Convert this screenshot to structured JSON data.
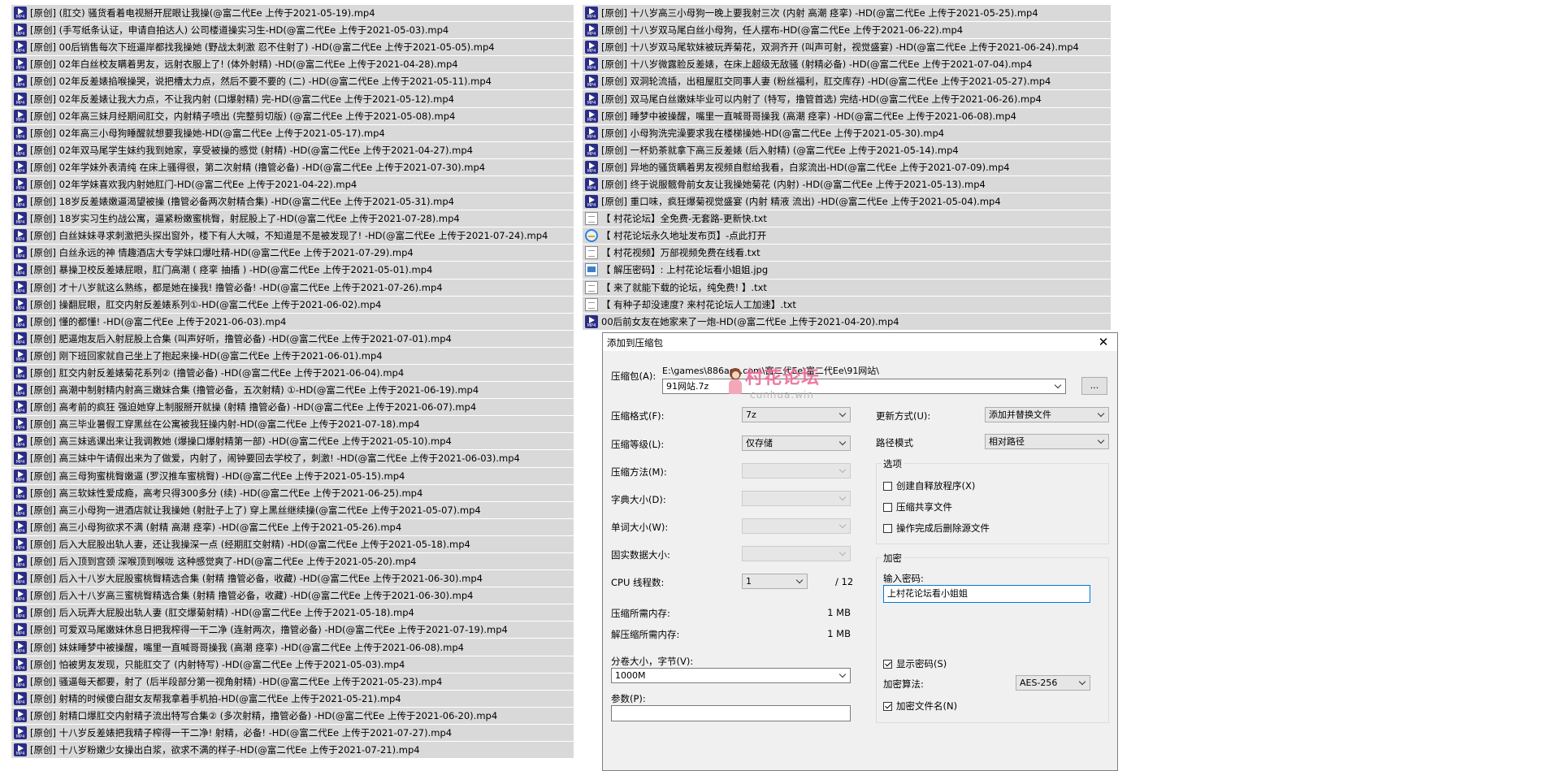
{
  "file_list": {
    "left": [
      {
        "name": "[原创]  (肛交) 骚货看着电视掰开屁眼让我操(@富二代Ee 上传于2021-05-19).mp4",
        "icon": "mp4-file-icon"
      },
      {
        "name": "[原创]  (手写纸条认证，申请自拍达人) 公司楼道操实习生-HD(@富二代Ee 上传于2021-05-03).mp4",
        "icon": "mp4-file-icon"
      },
      {
        "name": "[原创] 00后销售每次下班逼岸都找我操她 (野战太刺激 忍不住射了) -HD(@富二代Ee 上传于2021-05-05).mp4",
        "icon": "mp4-file-icon"
      },
      {
        "name": "[原创] 02年白丝校友瞒着男友，远射衣服上了! (体外射精) -HD(@富二代Ee 上传于2021-04-28).mp4",
        "icon": "mp4-file-icon"
      },
      {
        "name": "[原创] 02年反差婊掐喉操哭，说把槽太力点，然后不要不要的 (二) -HD(@富二代Ee 上传于2021-05-11).mp4",
        "icon": "mp4-file-icon"
      },
      {
        "name": "[原创] 02年反差婊让我大力点，不让我内射 (口爆射精) 完-HD(@富二代Ee 上传于2021-05-12).mp4",
        "icon": "mp4-file-icon"
      },
      {
        "name": "[原创] 02年高三妹月经期间肛交，内射精子喷出 (完整剪切版) (@富二代Ee 上传于2021-05-08).mp4",
        "icon": "mp4-file-icon"
      },
      {
        "name": "[原创] 02年高三小母狗睡醒就想要我操她-HD(@富二代Ee 上传于2021-05-17).mp4",
        "icon": "mp4-file-icon"
      },
      {
        "name": "[原创] 02年双马尾学生妹约我到她家，享受被操的感觉 (射精) -HD(@富二代Ee 上传于2021-04-27).mp4",
        "icon": "mp4-file-icon"
      },
      {
        "name": "[原创] 02年学妹外表清纯 在床上骚得很，第二次射精 (撸管必备) -HD(@富二代Ee 上传于2021-07-30).mp4",
        "icon": "mp4-file-icon"
      },
      {
        "name": "[原创] 02年学妹喜欢我内射她肛门-HD(@富二代Ee 上传于2021-04-22).mp4",
        "icon": "mp4-file-icon"
      },
      {
        "name": "[原创] 18岁反差婊嫩逼渴望被操 (撸管必备两次射精合集) -HD(@富二代Ee 上传于2021-05-31).mp4",
        "icon": "mp4-file-icon"
      },
      {
        "name": "[原创] 18岁实习生约战公寓，逼紧粉嫩蜜桃臀，射屁股上了-HD(@富二代Ee 上传于2021-07-28).mp4",
        "icon": "mp4-file-icon"
      },
      {
        "name": "[原创] 白丝妹妹寻求刺激把头探出窗外，楼下有人大喊，不知道是不是被发现了! -HD(@富二代Ee 上传于2021-07-24).mp4",
        "icon": "mp4-file-icon"
      },
      {
        "name": "[原创] 白丝永远的神 情趣酒店大专学妹口爆吐精-HD(@富二代Ee 上传于2021-07-29).mp4",
        "icon": "mp4-file-icon"
      },
      {
        "name": "[原创] 暴操卫校反差婊屁眼，肛门高潮 ( 痉挛 抽搐 ) -HD(@富二代Ee 上传于2021-05-01).mp4",
        "icon": "mp4-file-icon"
      },
      {
        "name": "[原创] 才十八岁就这么熟练，都是她在操我! 撸管必备! -HD(@富二代Ee 上传于2021-07-26).mp4",
        "icon": "mp4-file-icon"
      },
      {
        "name": "[原创] 操翻屁眼，肛交内射反差婊系列①-HD(@富二代Ee 上传于2021-06-02).mp4",
        "icon": "mp4-file-icon"
      },
      {
        "name": "[原创] 懂的都懂! -HD(@富二代Ee 上传于2021-06-03).mp4",
        "icon": "mp4-file-icon"
      },
      {
        "name": "[原创] 肥逼炮友后入射屁股上合集 (叫声好听，撸管必备) -HD(@富二代Ee 上传于2021-07-01).mp4",
        "icon": "mp4-file-icon"
      },
      {
        "name": "[原创] 刚下班回家就自己坐上了抱起来操-HD(@富二代Ee 上传于2021-06-01).mp4",
        "icon": "mp4-file-icon"
      },
      {
        "name": "[原创] 肛交内射反差婊菊花系列② (撸管必备) -HD(@富二代Ee 上传于2021-06-04).mp4",
        "icon": "mp4-file-icon"
      },
      {
        "name": "[原创] 高潮中制射精内射高三嫩妹合集 (撸管必备，五次射精) ①-HD(@富二代Ee 上传于2021-06-19).mp4",
        "icon": "mp4-file-icon"
      },
      {
        "name": "[原创] 高考前的疯狂 强迫她穿上制服掰开就操 (射精 撸管必备) -HD(@富二代Ee 上传于2021-06-07).mp4",
        "icon": "mp4-file-icon"
      },
      {
        "name": "[原创] 高三毕业暑假工穿黑丝在公寓被我狂操内射-HD(@富二代Ee 上传于2021-07-18).mp4",
        "icon": "mp4-file-icon"
      },
      {
        "name": "[原创] 高三妹逃课出来让我调教她 (爆操口爆射精第一部) -HD(@富二代Ee 上传于2021-05-10).mp4",
        "icon": "mp4-file-icon"
      },
      {
        "name": "[原创] 高三妹中午请假出来为了做爱，内射了，闹钟要回去学校了，刺激! -HD(@富二代Ee 上传于2021-06-03).mp4",
        "icon": "mp4-file-icon"
      },
      {
        "name": "[原创] 高三母狗蜜桃臀嫩逼 (罗汉推车蜜桃臀) -HD(@富二代Ee 上传于2021-05-15).mp4",
        "icon": "mp4-file-icon"
      },
      {
        "name": "[原创] 高三软妹性爱成瘾，高考只得300多分 (续) -HD(@富二代Ee 上传于2021-06-25).mp4",
        "icon": "mp4-file-icon"
      },
      {
        "name": "[原创] 高三小母狗一进酒店就让我操她 (射肚子上了) 穿上黑丝继续操(@富二代Ee 上传于2021-05-07).mp4",
        "icon": "mp4-file-icon"
      },
      {
        "name": "[原创] 高三小母狗欲求不满 (射精 高潮 痉挛) -HD(@富二代Ee 上传于2021-05-26).mp4",
        "icon": "mp4-file-icon"
      },
      {
        "name": "[原创] 后入大屁股出轨人妻，还让我操深一点 (经期肛交射精) -HD(@富二代Ee 上传于2021-05-18).mp4",
        "icon": "mp4-file-icon"
      },
      {
        "name": "[原创] 后入顶到宫颈 深喉顶到喉咙 这种感觉爽了-HD(@富二代Ee 上传于2021-05-20).mp4",
        "icon": "mp4-file-icon"
      },
      {
        "name": "[原创] 后入十八岁大屁股蜜桃臀精选合集 (射精 撸管必备，收藏) -HD(@富二代Ee 上传于2021-06-30).mp4",
        "icon": "mp4-file-icon"
      },
      {
        "name": "[原创] 后入十八岁高三蜜桃臀精选合集 (射精 撸管必备，收藏) -HD(@富二代Ee 上传于2021-06-30).mp4",
        "icon": "mp4-file-icon"
      },
      {
        "name": "[原创] 后入玩弄大屁股出轨人妻 (肛交爆菊射精) -HD(@富二代Ee 上传于2021-05-18).mp4",
        "icon": "mp4-file-icon"
      },
      {
        "name": "[原创] 可爱双马尾嫩妹休息日把我榨得一干二净 (连射两次，撸管必备) -HD(@富二代Ee 上传于2021-07-19).mp4",
        "icon": "mp4-file-icon"
      },
      {
        "name": "[原创] 妹妹睡梦中被操醒，嘴里一直喊哥哥操我 (高潮 痉挛) -HD(@富二代Ee 上传于2021-06-08).mp4",
        "icon": "mp4-file-icon"
      },
      {
        "name": "[原创] 怕被男友发现，只能肛交了 (内射特写) -HD(@富二代Ee 上传于2021-05-03).mp4",
        "icon": "mp4-file-icon"
      },
      {
        "name": "[原创] 骚逼每天都要，射了 (后半段部分第一视角射精) -HD(@富二代Ee 上传于2021-05-23).mp4",
        "icon": "mp4-file-icon"
      },
      {
        "name": "[原创] 射精的时候傻白甜女友帮我拿着手机拍-HD(@富二代Ee 上传于2021-05-21).mp4",
        "icon": "mp4-file-icon"
      },
      {
        "name": "[原创] 射精口爆肛交内射精子流出特写合集② (多次射精，撸管必备) -HD(@富二代Ee 上传于2021-06-20).mp4",
        "icon": "mp4-file-icon"
      },
      {
        "name": "[原创] 十八岁反差婊把我精子榨得一干二净! 射精，必备! -HD(@富二代Ee 上传于2021-07-27).mp4",
        "icon": "mp4-file-icon"
      },
      {
        "name": "[原创] 十八岁粉嫩少女操出白浆，欲求不满的样子-HD(@富二代Ee 上传于2021-07-21).mp4",
        "icon": "mp4-file-icon"
      }
    ],
    "right": [
      {
        "name": "[原创] 十八岁高三小母狗一晚上要我射三次 (内射 高潮 痉挛) -HD(@富二代Ee 上传于2021-05-25).mp4",
        "icon": "mp4-file-icon"
      },
      {
        "name": "[原创] 十八岁双马尾白丝小母狗，任人摆布-HD(@富二代Ee 上传于2021-06-22).mp4",
        "icon": "mp4-file-icon"
      },
      {
        "name": "[原创] 十八岁双马尾软妹被玩弄菊花，双洞齐开 (叫声可射，视觉盛宴) -HD(@富二代Ee 上传于2021-06-24).mp4",
        "icon": "mp4-file-icon"
      },
      {
        "name": "[原创] 十八岁微露脸反差婊，在床上超级无敌骚 (射精必备) -HD(@富二代Ee 上传于2021-07-04).mp4",
        "icon": "mp4-file-icon"
      },
      {
        "name": "[原创] 双洞轮流插，出租屋肛交同事人妻 (粉丝福利，肛交库存) -HD(@富二代Ee 上传于2021-05-27).mp4",
        "icon": "mp4-file-icon"
      },
      {
        "name": "[原创] 双马尾白丝嫩妹毕业可以内射了 (特写，撸管首选) 完结-HD(@富二代Ee 上传于2021-06-26).mp4",
        "icon": "mp4-file-icon"
      },
      {
        "name": "[原创] 睡梦中被操醒，嘴里一直喊哥哥操我 (高潮 痉挛) -HD(@富二代Ee 上传于2021-06-08).mp4",
        "icon": "mp4-file-icon"
      },
      {
        "name": "[原创] 小母狗洗完澡要求我在楼梯操她-HD(@富二代Ee 上传于2021-05-30).mp4",
        "icon": "mp4-file-icon"
      },
      {
        "name": "[原创] 一杯奶茶就拿下高三反差婊 (后入射精) (@富二代Ee 上传于2021-05-14).mp4",
        "icon": "mp4-file-icon"
      },
      {
        "name": "[原创] 异地的骚货瞒着男友视频自慰给我看，白浆流出-HD(@富二代Ee 上传于2021-07-09).mp4",
        "icon": "mp4-file-icon"
      },
      {
        "name": "[原创] 终于说服髋骨前女友让我操她菊花 (内射) -HD(@富二代Ee 上传于2021-05-13).mp4",
        "icon": "mp4-file-icon"
      },
      {
        "name": "[原创] 重口味，疯狂爆菊视觉盛宴 (内射 精液 流出) -HD(@富二代Ee 上传于2021-05-04).mp4",
        "icon": "mp4-file-icon"
      },
      {
        "name": "【 村花论坛】全免费-无套路-更新快.txt",
        "icon": "text-file-icon"
      },
      {
        "name": "【 村花论坛永久地址发布页】-点此打开",
        "icon": "internet-shortcut-icon"
      },
      {
        "name": "【 村花视频】万部视频免费在线看.txt",
        "icon": "text-file-icon"
      },
      {
        "name": "【 解压密码】: 上村花论坛看小姐姐.jpg",
        "icon": "image-file-icon"
      },
      {
        "name": "【 来了就能下载的论坛，纯免费! 】.txt",
        "icon": "text-file-icon"
      },
      {
        "name": "【 有种子却没速度? 来村花论坛人工加速】.txt",
        "icon": "text-file-icon"
      },
      {
        "name": "00后前女友在她家来了一炮-HD(@富二代Ee 上传于2021-04-20).mp4",
        "icon": "mp4-file-icon"
      }
    ]
  },
  "dialog": {
    "title": "添加到压缩包",
    "close_glyph": "✕",
    "archive_label": "压缩包(A):",
    "archive_path": "E:\\games\\886acg.com\\富二代Ee\\富二代Ee\\91网站\\",
    "archive_name": "91网站.7z",
    "browse_label": "...",
    "format_label": "压缩格式(F):",
    "format_value": "7z",
    "level_label": "压缩等级(L):",
    "level_value": "仅存储",
    "method_label": "压缩方法(M):",
    "method_value": "",
    "dict_label": "字典大小(D):",
    "dict_value": "",
    "word_label": "单词大小(W):",
    "word_value": "",
    "solid_label": "固实数据大小:",
    "solid_value": "",
    "cpu_label": "CPU 线程数:",
    "cpu_value": "1",
    "cpu_max": "/ 12",
    "mem_comp_label": "压缩所需内存:",
    "mem_comp_value": "1 MB",
    "mem_decomp_label": "解压缩所需内存:",
    "mem_decomp_value": "1 MB",
    "volume_label": "分卷大小，字节(V):",
    "volume_value": "1000M",
    "params_label": "参数(P):",
    "params_value": "",
    "update_label": "更新方式(U):",
    "update_value": "添加并替换文件",
    "pathmode_label": "路径模式",
    "pathmode_value": "相对路径",
    "options_title": "选项",
    "opt_sfx": "创建自释放程序(X)",
    "opt_shared": "压缩共享文件",
    "opt_delete": "操作完成后删除源文件",
    "encrypt_title": "加密",
    "password_label": "输入密码:",
    "password_value": "上村花论坛看小姐姐",
    "show_password": "显示密码(S)",
    "enc_method_label": "加密算法:",
    "enc_method_value": "AES-256",
    "encrypt_names": "加密文件名(N)",
    "checks": {
      "sfx": false,
      "shared": false,
      "delete": false,
      "show_password": true,
      "encrypt_names": true
    }
  },
  "watermark": {
    "text": "村花论坛",
    "subtext": "cunhua.win"
  }
}
